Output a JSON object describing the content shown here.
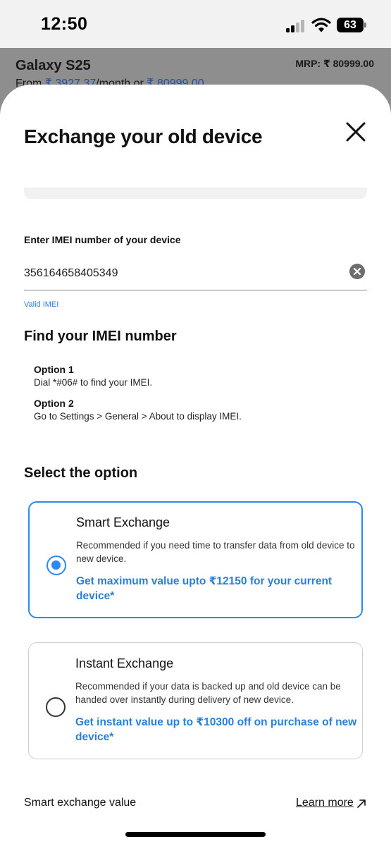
{
  "status_bar": {
    "time": "12:50",
    "battery": "63",
    "icons": [
      "signal-icon",
      "wifi-icon",
      "battery-icon"
    ]
  },
  "product": {
    "name": "Galaxy S25",
    "mrp": "MRP: ₹ 80999.00",
    "from_prefix": "From ",
    "monthly_price": "₹ 3927.37",
    "monthly_suffix": "/month or ",
    "full_price": "₹ 80999.00"
  },
  "sheet": {
    "title": "Exchange your old device",
    "imei": {
      "label": "Enter IMEI number of your device",
      "value": "356164658405349",
      "status": "Valid IMEI"
    },
    "find_imei": {
      "title": "Find your IMEI number",
      "options": [
        {
          "heading": "Option 1",
          "text": "Dial *#06# to find your IMEI."
        },
        {
          "heading": "Option 2",
          "text": "Go to Settings > General > About to display IMEI."
        }
      ]
    },
    "select_option": {
      "title": "Select the option",
      "cards": [
        {
          "title": "Smart Exchange",
          "description": "Recommended if you need time to transfer data from old device to new device.",
          "offer": "Get maximum value upto ₹12150 for your current device*",
          "selected": true
        },
        {
          "title": "Instant Exchange",
          "description": "Recommended if your data is backed up and old device can be handed over instantly during delivery of new device.",
          "offer": "Get instant value up to ₹10300 off on purchase of new device*",
          "selected": false
        }
      ]
    },
    "footer": {
      "value_label": "Smart exchange value",
      "learn_more": "Learn more"
    }
  },
  "colors": {
    "accent": "#2b89f0",
    "offer_text": "#2b7fd9",
    "valid_text": "#2c7be5",
    "overlay": "#8e8e8e"
  }
}
